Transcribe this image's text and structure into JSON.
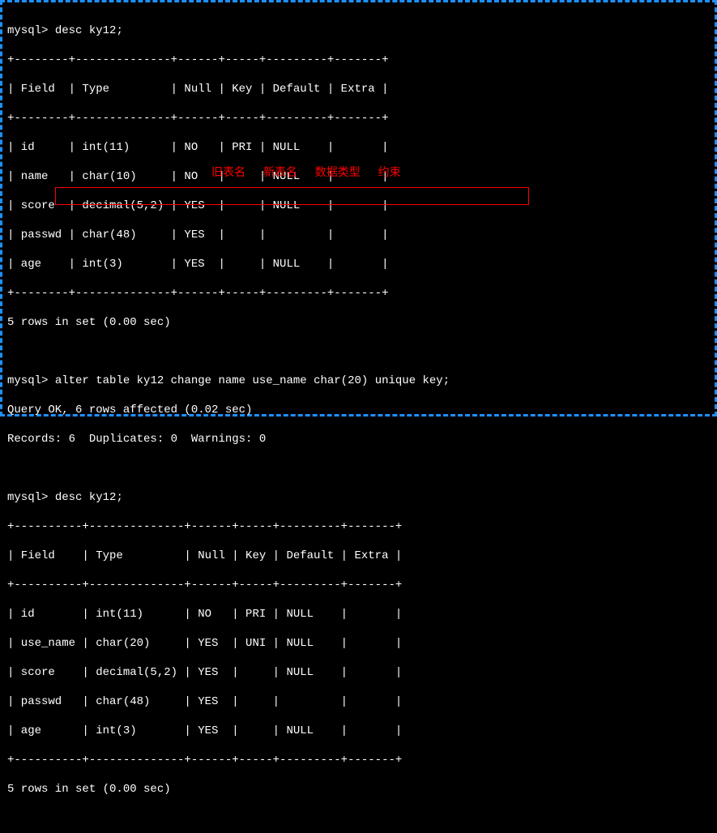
{
  "prompt": "mysql>",
  "commands": {
    "desc1": "desc ky12;",
    "alter": "alter table ky12 change name use_name char(20) unique key;",
    "desc2": "desc ky12;"
  },
  "table1": {
    "sep_top": "+--------+--------------+------+-----+---------+-------+",
    "header": "| Field  | Type         | Null | Key | Default | Extra |",
    "sep_mid": "+--------+--------------+------+-----+---------+-------+",
    "rows": [
      "| id     | int(11)      | NO   | PRI | NULL    |       |",
      "| name   | char(10)     | NO   |     | NULL    |       |",
      "| score  | decimal(5,2) | YES  |     | NULL    |       |",
      "| passwd | char(48)     | YES  |     |         |       |",
      "| age    | int(3)       | YES  |     | NULL    |       |"
    ],
    "sep_bot": "+--------+--------------+------+-----+---------+-------+",
    "result": "5 rows in set (0.00 sec)"
  },
  "alter_result": {
    "line1": "Query OK, 6 rows affected (0.02 sec)",
    "line2": "Records: 6  Duplicates: 0  Warnings: 0"
  },
  "table2": {
    "sep_top": "+----------+--------------+------+-----+---------+-------+",
    "header": "| Field    | Type         | Null | Key | Default | Extra |",
    "sep_mid": "+----------+--------------+------+-----+---------+-------+",
    "rows": [
      "| id       | int(11)      | NO   | PRI | NULL    |       |",
      "| use_name | char(20)     | YES  | UNI | NULL    |       |",
      "| score    | decimal(5,2) | YES  |     | NULL    |       |",
      "| passwd   | char(48)     | YES  |     |         |       |",
      "| age      | int(3)       | YES  |     | NULL    |       |"
    ],
    "sep_bot": "+----------+--------------+------+-----+---------+-------+",
    "result": "5 rows in set (0.00 sec)"
  },
  "annotations": {
    "a1": "旧表名",
    "a2": "新表名",
    "a3": "数据类型",
    "a4": "约束"
  }
}
